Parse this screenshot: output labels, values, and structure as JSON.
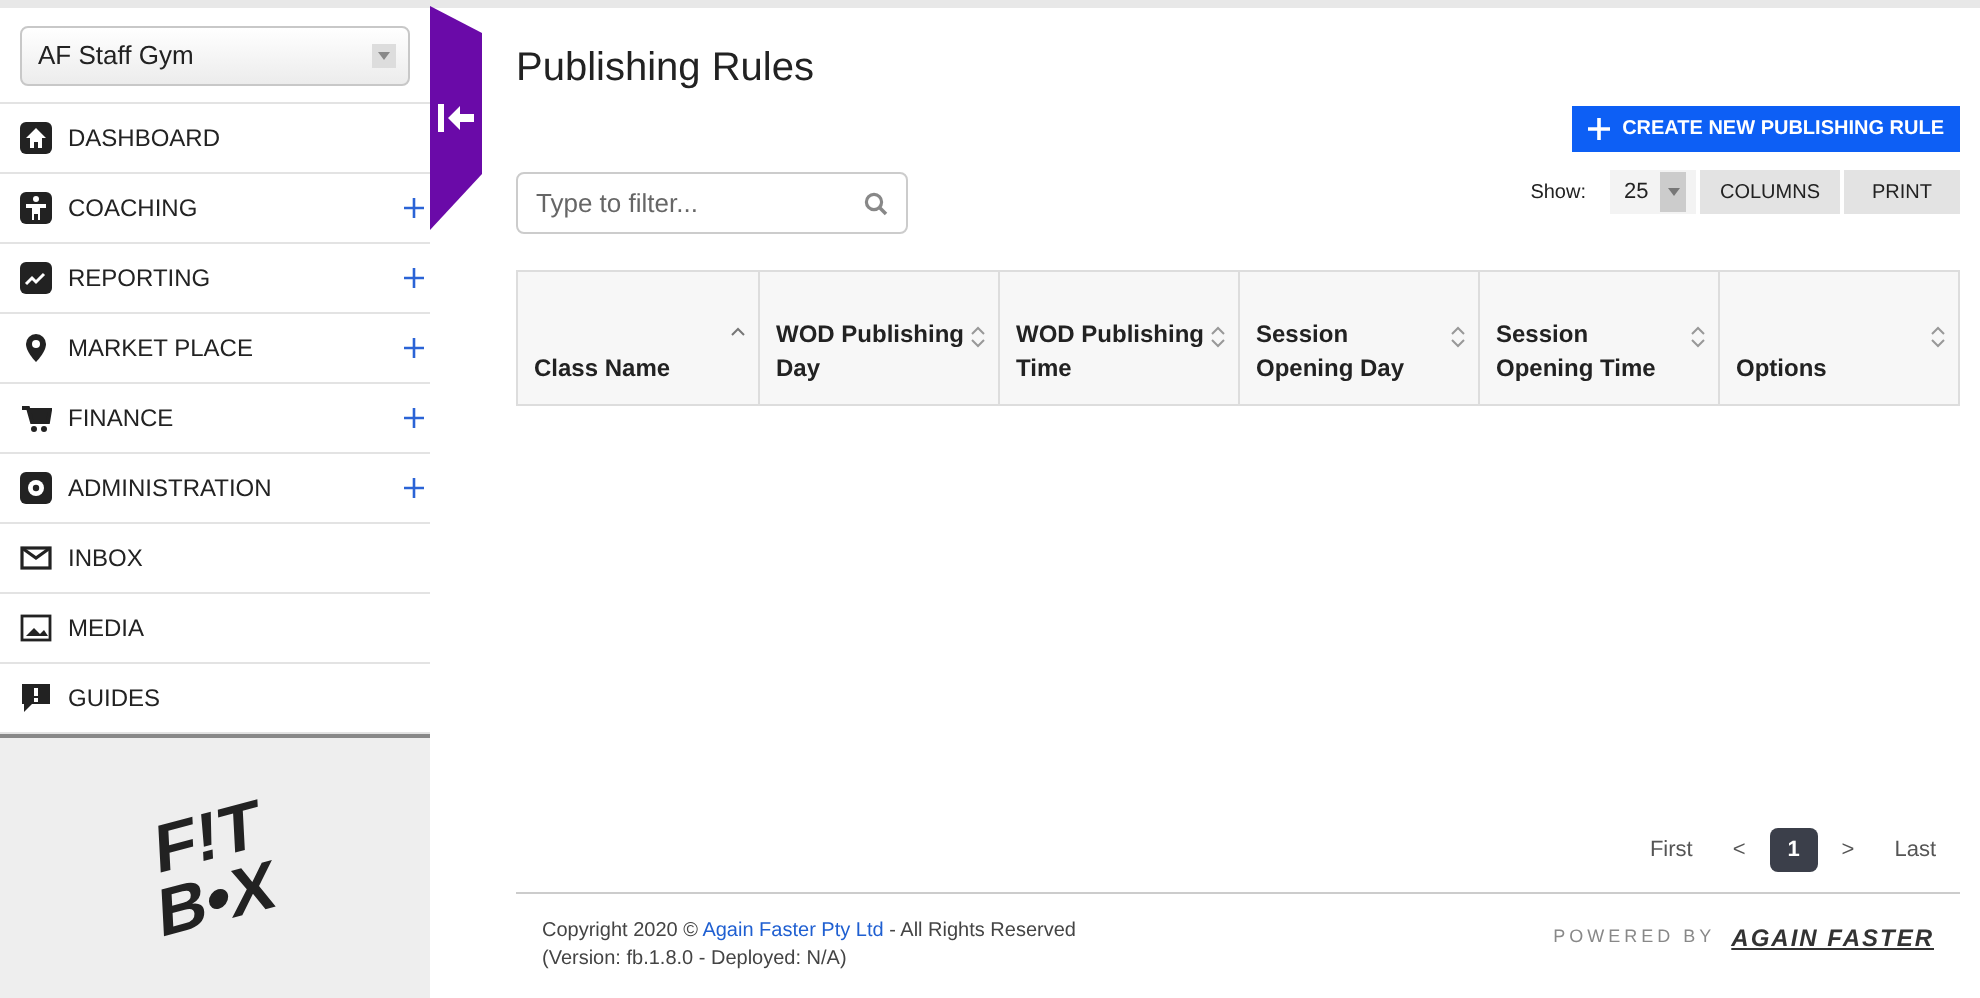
{
  "sidebar": {
    "gym_select": {
      "value": "AF Staff Gym"
    },
    "items": [
      {
        "label": "DASHBOARD",
        "expandable": false
      },
      {
        "label": "COACHING",
        "expandable": true
      },
      {
        "label": "REPORTING",
        "expandable": true
      },
      {
        "label": "MARKET PLACE",
        "expandable": true
      },
      {
        "label": "FINANCE",
        "expandable": true
      },
      {
        "label": "ADMINISTRATION",
        "expandable": true
      },
      {
        "label": "INBOX",
        "expandable": false
      },
      {
        "label": "MEDIA",
        "expandable": false
      },
      {
        "label": "GUIDES",
        "expandable": false
      }
    ],
    "logo": [
      "F!T",
      "B•X"
    ]
  },
  "page": {
    "title": "Publishing Rules",
    "create_button": "CREATE NEW PUBLISHING RULE",
    "filter": {
      "placeholder": "Type to filter..."
    },
    "show_label": "Show:",
    "page_size": "25",
    "columns_button": "COLUMNS",
    "print_button": "PRINT"
  },
  "table": {
    "columns": [
      {
        "label": "Class Name",
        "sorted": true
      },
      {
        "label": "WOD Publishing Day",
        "sorted": false
      },
      {
        "label": "WOD Publishing Time",
        "sorted": false
      },
      {
        "label": "Session Opening Day",
        "sorted": false
      },
      {
        "label": "Session Opening Time",
        "sorted": false
      },
      {
        "label": "Options",
        "sorted": false
      }
    ]
  },
  "pagination": [
    {
      "label": "First",
      "selected": false
    },
    {
      "label": "<",
      "selected": false
    },
    {
      "label": "1",
      "selected": true
    },
    {
      "label": ">",
      "selected": false
    },
    {
      "label": "Last",
      "selected": false
    }
  ],
  "footer": {
    "copyright": "Copyright 2020 © ",
    "company_link": "Again Faster Pty Ltd",
    "rights": " - All Rights Reserved",
    "version": "(Version: fb.1.8.0 - Deployed: N/A)",
    "powered_by": "POWERED BY",
    "brand": "AGAIN FASTER"
  }
}
